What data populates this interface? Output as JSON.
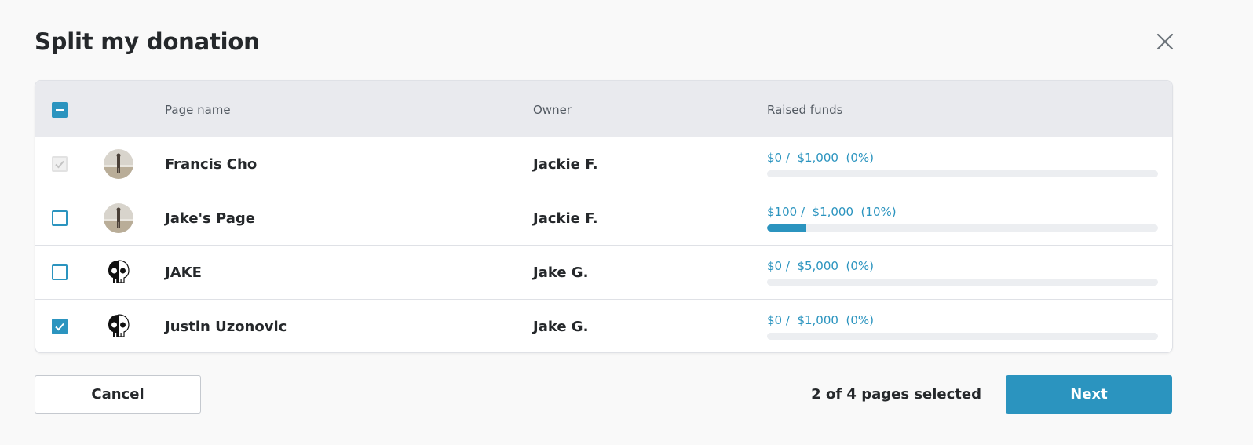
{
  "dialog": {
    "title": "Split my donation",
    "close_icon": "close-icon"
  },
  "table": {
    "headers": {
      "page_name": "Page name",
      "owner": "Owner",
      "raised_funds": "Raised funds"
    },
    "header_checkbox_state": "indeterminate",
    "rows": [
      {
        "page_name": "Francis Cho",
        "owner": "Jackie F.",
        "funds_label": "$0 /  $1,000  (0%)",
        "raised": 0,
        "goal": 1000,
        "percent": 0,
        "checkbox_state": "disabled-checked",
        "avatar": "person-photo-avatar"
      },
      {
        "page_name": "Jake's Page",
        "owner": "Jackie F.",
        "funds_label": "$100 /  $1,000  (10%)",
        "raised": 100,
        "goal": 1000,
        "percent": 10,
        "checkbox_state": "unchecked",
        "avatar": "person-photo-avatar"
      },
      {
        "page_name": "JAKE",
        "owner": "Jake G.",
        "funds_label": "$0 /  $5,000  (0%)",
        "raised": 0,
        "goal": 5000,
        "percent": 0,
        "checkbox_state": "unchecked",
        "avatar": "skull-avatar"
      },
      {
        "page_name": "Justin Uzonovic",
        "owner": "Jake G.",
        "funds_label": "$0 /  $1,000  (0%)",
        "raised": 0,
        "goal": 1000,
        "percent": 0,
        "checkbox_state": "checked",
        "avatar": "skull-avatar"
      }
    ]
  },
  "footer": {
    "cancel_label": "Cancel",
    "selected_text": "2 of 4 pages selected",
    "next_label": "Next"
  },
  "colors": {
    "accent": "#2b94bf",
    "background": "#f9f9f9",
    "header_bg": "#e9eaee",
    "text": "#25282b"
  }
}
